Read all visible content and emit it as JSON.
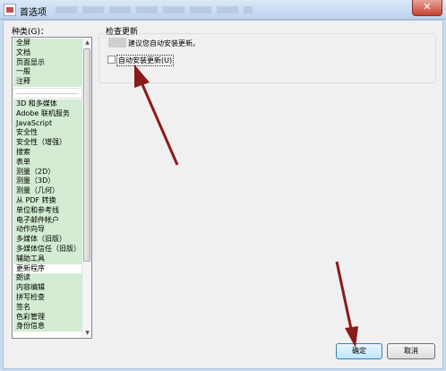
{
  "window": {
    "title": "首选项",
    "close_glyph": "✕"
  },
  "categories": {
    "label": "种类(G)：",
    "group1": [
      "全屏",
      "文档",
      "页面显示",
      "一般",
      "注释"
    ],
    "group2": [
      "3D 和多媒体",
      "Adobe 联机服务",
      "JavaScript",
      "安全性",
      "安全性（增强）",
      "搜索",
      "表单",
      "测量（2D）",
      "测量（3D）",
      "测量（几何）",
      "从 PDF 转换",
      "单位和参考线",
      "电子邮件帐户",
      "动作向导",
      "多媒体（旧版）",
      "多媒体信任（旧版）",
      "辅助工具",
      "更新程序",
      "朗读",
      "内容编辑",
      "拼写检查",
      "签名",
      "色彩管理",
      "身份信息"
    ],
    "selected": "更新程序"
  },
  "update_section": {
    "title": "检查更新",
    "info": "建议您自动安装更新。",
    "auto_install_label": "自动安装更新(U)",
    "auto_install_checked": false
  },
  "buttons": {
    "ok": "确定",
    "cancel": "取消"
  },
  "colors": {
    "annotation_arrow": "#8b1a1a",
    "list_highlight": "#d3ecd3"
  }
}
